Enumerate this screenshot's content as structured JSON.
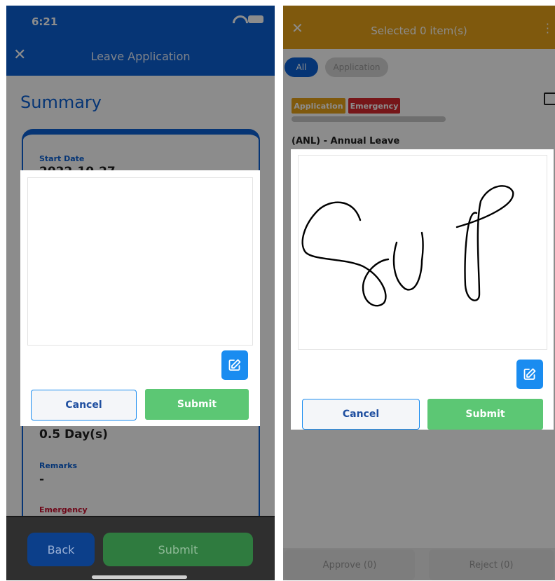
{
  "left": {
    "status": {
      "time": "6:21",
      "wifi_icon": "wifi-icon",
      "battery_icon": "battery-icon"
    },
    "header": {
      "close_icon": "close-icon",
      "title": "Leave Application"
    },
    "summary_title": "Summary",
    "fields": {
      "start_date_label": "Start Date",
      "start_date_value": "2022-10-27",
      "duration_value": "0.5 Day(s)",
      "remarks_label": "Remarks",
      "remarks_value": "-",
      "emergency_label": "Emergency"
    },
    "bottom": {
      "back_label": "Back",
      "submit_label": "Submit"
    },
    "modal": {
      "edit_icon": "edit-icon",
      "cancel_label": "Cancel",
      "submit_label": "Submit"
    }
  },
  "right": {
    "header": {
      "close_icon": "close-icon",
      "title": "Selected 0 item(s)",
      "menu_icon": "more-vertical-icon"
    },
    "filters": [
      "All",
      "Application"
    ],
    "item": {
      "tags": [
        "Application",
        "Emergency"
      ],
      "leave_type": "(ANL) - Annual Leave"
    },
    "modal": {
      "edit_icon": "edit-icon",
      "cancel_label": "Cancel",
      "submit_label": "Submit"
    },
    "bottom": {
      "approve_label": "Approve (0)",
      "reject_label": "Reject (0)"
    }
  },
  "colors": {
    "primary_blue": "#0b62d6",
    "header_orange": "#e8a318",
    "submit_green": "#5cc774",
    "emergency_red": "#d8282f",
    "edit_blue": "#1a8cf0"
  }
}
